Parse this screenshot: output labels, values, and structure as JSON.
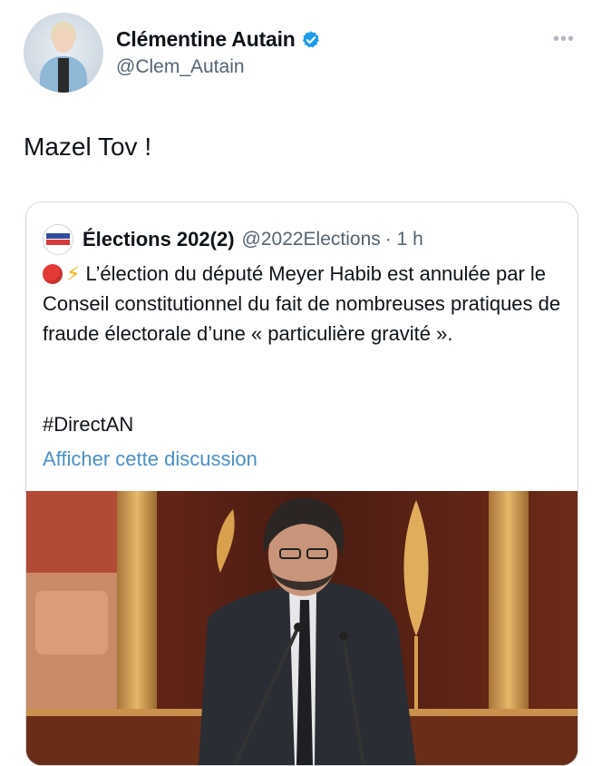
{
  "author": {
    "display_name": "Clémentine Autain",
    "handle": "@Clem_Autain",
    "verified": true,
    "avatar_icon": "profile-photo"
  },
  "more_icon": "ellipsis-icon",
  "tweet": {
    "text": "Mazel Tov !"
  },
  "quoted_tweet": {
    "display_name": "Élections 202(2)",
    "handle": "@2022Elections",
    "time": "· 1 h",
    "icons": [
      "red-circle",
      "lightning"
    ],
    "text": "L’élection du député Meyer Habib est annulée par le Conseil constitutionnel du fait de nombreuses pratiques de fraude électorale d’une « particulière gravité ».",
    "hashtag": "#DirectAN",
    "show_thread": "Afficher cette discussion",
    "media": "photo of a man speaking at a podium in the National Assembly"
  },
  "colors": {
    "verified": "#1d9bf0",
    "link": "#4a90c9",
    "muted": "#536471",
    "red_dot": "#e53935",
    "bolt": "#f5b400"
  }
}
